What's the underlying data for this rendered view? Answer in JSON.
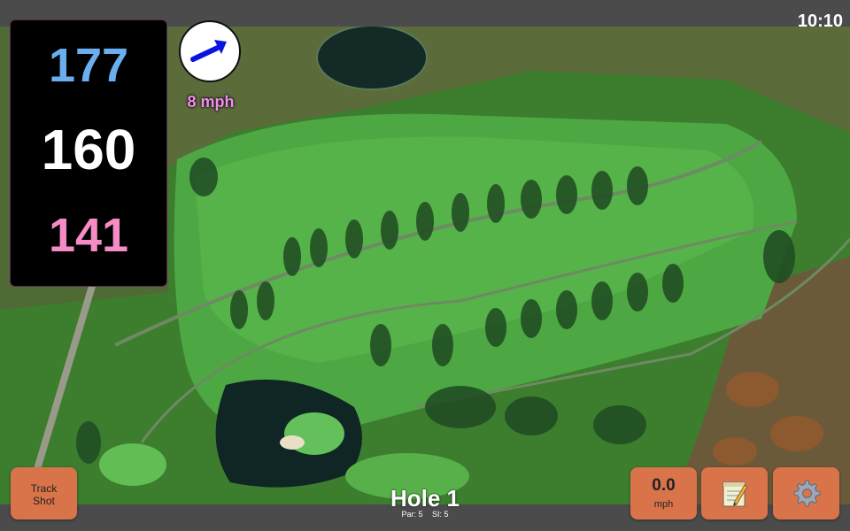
{
  "status": {
    "time": "10:10"
  },
  "yardages": {
    "back": "177",
    "middle": "160",
    "front": "141",
    "colors": {
      "back": "#6aaef0",
      "middle": "#ffffff",
      "front": "#f58cc6"
    }
  },
  "wind": {
    "speed_label": "8 mph",
    "arrow_icon": "wind-direction-arrow-icon",
    "arrow_color": "#0a14e0",
    "label_color": "#f58cf0"
  },
  "buttons": {
    "track_shot": "Track\nShot",
    "speed_value": "0.0",
    "speed_unit": "mph",
    "notes_icon": "notepad-icon",
    "settings_icon": "gear-icon",
    "accent": "#d9734a"
  },
  "hole": {
    "title": "Hole 1",
    "par": "Par: 5",
    "si": "SI: 5"
  }
}
